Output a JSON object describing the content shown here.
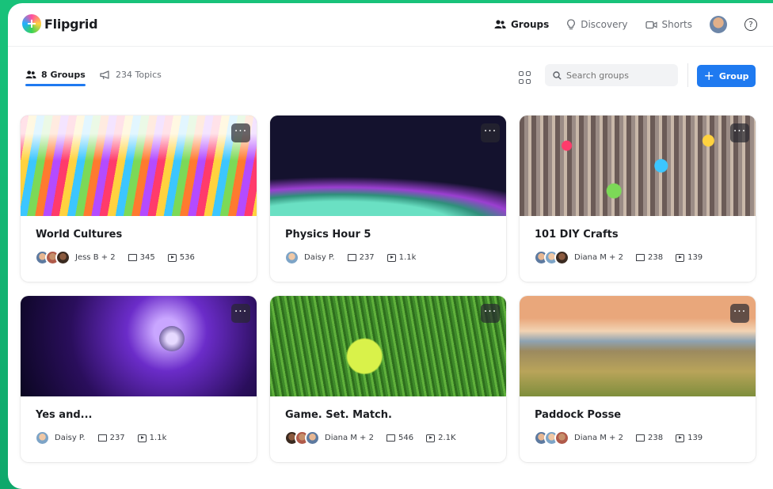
{
  "app": {
    "name": "Flipgrid",
    "logo_glyph": "+"
  },
  "nav": {
    "items": [
      {
        "label": "Groups",
        "icon": "people-icon",
        "active": true
      },
      {
        "label": "Discovery",
        "icon": "lightbulb-icon",
        "active": false
      },
      {
        "label": "Shorts",
        "icon": "video-camera-icon",
        "active": false
      }
    ],
    "help_glyph": "?"
  },
  "toolbar": {
    "tabs": [
      {
        "label": "8 Groups",
        "icon": "people-icon",
        "active": true
      },
      {
        "label": "234 Topics",
        "icon": "megaphone-icon",
        "active": false
      }
    ],
    "search_placeholder": "Search groups",
    "add_label": "Group",
    "add_glyph": "+"
  },
  "groups": [
    {
      "title": "World Cultures",
      "members": "Jess B + 2",
      "topics": "345",
      "videos": "536"
    },
    {
      "title": "Physics Hour 5",
      "members": "Daisy P.",
      "topics": "237",
      "videos": "1.1k"
    },
    {
      "title": "101 DIY Crafts",
      "members": "Diana M + 2",
      "topics": "238",
      "videos": "139"
    },
    {
      "title": "Yes and...",
      "members": "Daisy P.",
      "topics": "237",
      "videos": "1.1k"
    },
    {
      "title": "Game. Set. Match.",
      "members": "Diana M + 2",
      "topics": "546",
      "videos": "2.1K"
    },
    {
      "title": "Paddock Posse",
      "members": "Diana M + 2",
      "topics": "238",
      "videos": "139"
    }
  ],
  "more_glyph": "···",
  "colors": {
    "accent": "#1f7af0",
    "frame": "#18c27a"
  }
}
